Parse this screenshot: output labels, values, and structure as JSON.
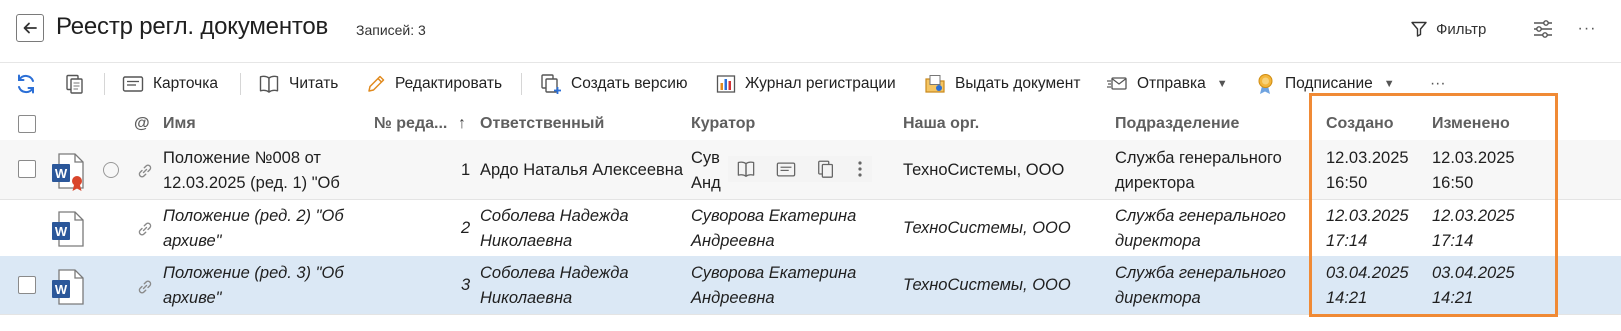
{
  "header": {
    "title": "Реестр регл. документов",
    "records": "Записей: 3",
    "filter_label": "Фильтр",
    "more": "···"
  },
  "toolbar": {
    "card": "Карточка",
    "read": "Читать",
    "edit": "Редактировать",
    "create_version": "Создать версию",
    "journal": "Журнал регистрации",
    "issue_document": "Выдать документ",
    "send": "Отправка",
    "sign": "Подписание",
    "more": "···"
  },
  "columns": {
    "at": "@",
    "name": "Имя",
    "edition": "№ реда...",
    "sort_arrow": "↑",
    "responsible": "Ответственный",
    "curator": "Куратор",
    "org": "Наша орг.",
    "department": "Подразделение",
    "created": "Создано",
    "modified": "Изменено"
  },
  "rows": [
    {
      "name_l1": "Положение №008 от",
      "name_l2": "12.03.2025 (ред. 1) \"Об",
      "edition": "1",
      "responsible_l1": "Ардо Наталья Алексеевна",
      "responsible_l2": "",
      "curator_l1": "Сув",
      "curator_l2": "Анд",
      "org": "ТехноСистемы, ООО",
      "dept_l1": "Служба генерального",
      "dept_l2": "директора",
      "created_l1": "12.03.2025",
      "created_l2": "16:50",
      "modified_l1": "12.03.2025",
      "modified_l2": "16:50"
    },
    {
      "name_l1": "Положение (ред. 2) \"Об",
      "name_l2": "архиве\"",
      "edition": "2",
      "responsible_l1": "Соболева Надежда",
      "responsible_l2": "Николаевна",
      "curator_l1": "Суворова Екатерина",
      "curator_l2": "Андреевна",
      "org": "ТехноСистемы, ООО",
      "dept_l1": "Служба генерального",
      "dept_l2": "директора",
      "created_l1": "12.03.2025",
      "created_l2": "17:14",
      "modified_l1": "12.03.2025",
      "modified_l2": "17:14"
    },
    {
      "name_l1": "Положение (ред. 3) \"Об",
      "name_l2": "архиве\"",
      "edition": "3",
      "responsible_l1": "Соболева Надежда",
      "responsible_l2": "Николаевна",
      "curator_l1": "Суворова Екатерина",
      "curator_l2": "Андреевна",
      "org": "ТехноСистемы, ООО",
      "dept_l1": "Служба генерального",
      "dept_l2": "директора",
      "created_l1": "03.04.2025",
      "created_l2": "14:21",
      "modified_l1": "03.04.2025",
      "modified_l2": "14:21"
    }
  ],
  "colors": {
    "accent": "#2b6fd6",
    "selected_row": "#dbe8f5",
    "highlight": "#f08a35",
    "word_blue": "#2b579a"
  },
  "icons": {
    "refresh": "refresh-icon",
    "copy": "copy-icon",
    "card": "card-icon",
    "read": "book-icon",
    "edit": "pencil-icon",
    "create_version": "add-version-icon",
    "journal": "bar-chart-icon",
    "issue": "folder-icon",
    "send": "send-icon",
    "sign": "medal-icon",
    "filter": "filter-icon",
    "settings": "sliders-icon",
    "back": "arrow-left-icon",
    "doc": "word-document-icon",
    "link": "link-icon"
  }
}
